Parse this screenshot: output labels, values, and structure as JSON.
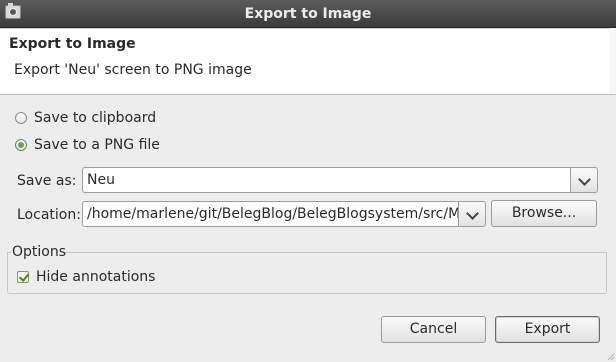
{
  "window": {
    "title": "Export to Image"
  },
  "header": {
    "title": "Export to Image",
    "description": "Export 'Neu' screen to PNG image"
  },
  "destination": {
    "options": [
      {
        "label": "Save to clipboard",
        "selected": false
      },
      {
        "label": "Save to a PNG file",
        "selected": true
      }
    ]
  },
  "save_as": {
    "label": "Save as:",
    "value": "Neu"
  },
  "location": {
    "label": "Location:",
    "value": "/home/marlene/git/BelegBlog/BelegBlogsystem/src/Mock",
    "browse_label": "Browse..."
  },
  "options_group": {
    "title": "Options",
    "hide_annotations": {
      "label": "Hide annotations",
      "checked": true
    }
  },
  "buttons": {
    "cancel": "Cancel",
    "export": "Export"
  },
  "colors": {
    "titlebar": "#3b3b3b",
    "radio_selected": "#73a153",
    "background": "#ededed"
  }
}
